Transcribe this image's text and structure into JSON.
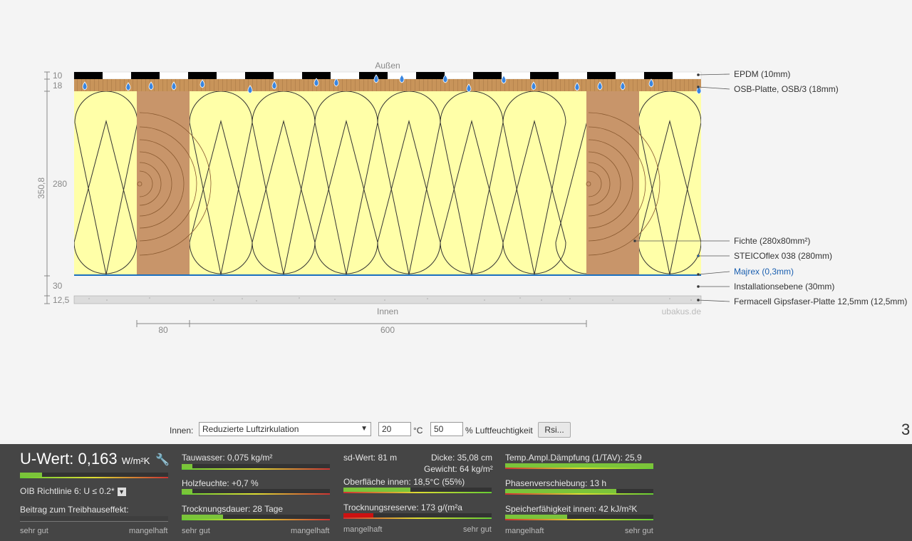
{
  "diagram": {
    "outside_label": "Außen",
    "inside_label": "Innen",
    "watermark": "ubakus.de",
    "thickness_labels": [
      "10",
      "18",
      "280",
      "30",
      "12,5"
    ],
    "total_thickness": "350,8",
    "width_labels": [
      "80",
      "600"
    ],
    "layers": [
      {
        "label": "EPDM (10mm)",
        "color": "#000000"
      },
      {
        "label": "OSB-Platte, OSB/3 (18mm)",
        "color": "#c8945a"
      },
      {
        "label": "Fichte (280x80mm²)",
        "color": "#c8956a"
      },
      {
        "label": "STEICOflex 038 (280mm)",
        "color": "#ffffa8"
      },
      {
        "label": "Majrex (0,3mm)",
        "color": "#1a6fbf"
      },
      {
        "label": "Installationsebene (30mm)",
        "color": "#f4f4f4"
      },
      {
        "label": "Fermacell Gipsfaser-Platte 12,5mm (12,5mm)",
        "color": "#dcdcdc"
      }
    ]
  },
  "controls": {
    "innen_label": "Innen:",
    "climate_select": "Reduzierte Luftzirkulation",
    "temperature": "20",
    "temp_unit": "°C",
    "humidity": "50",
    "humidity_label": "% Luftfeuchtigkeit",
    "rsi_button": "Rsi...",
    "page_indicator": "3"
  },
  "results": {
    "uwert_label": "U-Wert:",
    "uwert_value": "0,163",
    "uwert_unit": "W/m²K",
    "uwert_fraction": 0.15,
    "oib": "OIB Richtlinie 6: U ≤ 0.2*",
    "treibhaus": "Beitrag zum Treibhauseffekt:",
    "tauwasser": "Tauwasser: 0,075 kg/m²",
    "tauwasser_fraction": 0.07,
    "holzfeuchte": "Holzfeuchte: +0,7 %",
    "holzfeuchte_fraction": 0.07,
    "trocknungsdauer": "Trocknungsdauer: 28 Tage",
    "trocknungsdauer_fraction": 0.28,
    "sdwert": "sd-Wert: 81 m",
    "dicke": "Dicke: 35,08 cm",
    "gewicht": "Gewicht: 64 kg/m²",
    "oberflaeche": "Oberfläche innen: 18,5°C (55%)",
    "oberflaeche_fraction": 0.45,
    "trocknungsreserve": "Trocknungsreserve: 173 g/(m²a",
    "trocknungsreserve_fraction": 0.2,
    "temp_ampl": "Temp.Ampl.Dämpfung (1/TAV): 25,9",
    "temp_ampl_fraction": 1.0,
    "phasen": "Phasenverschiebung: 13 h",
    "phasen_fraction": 0.75,
    "speicher": "Speicherfähigkeit innen: 42 kJ/m²K",
    "speicher_fraction": 0.42,
    "scale_good": "sehr gut",
    "scale_bad": "mangelhaft"
  }
}
